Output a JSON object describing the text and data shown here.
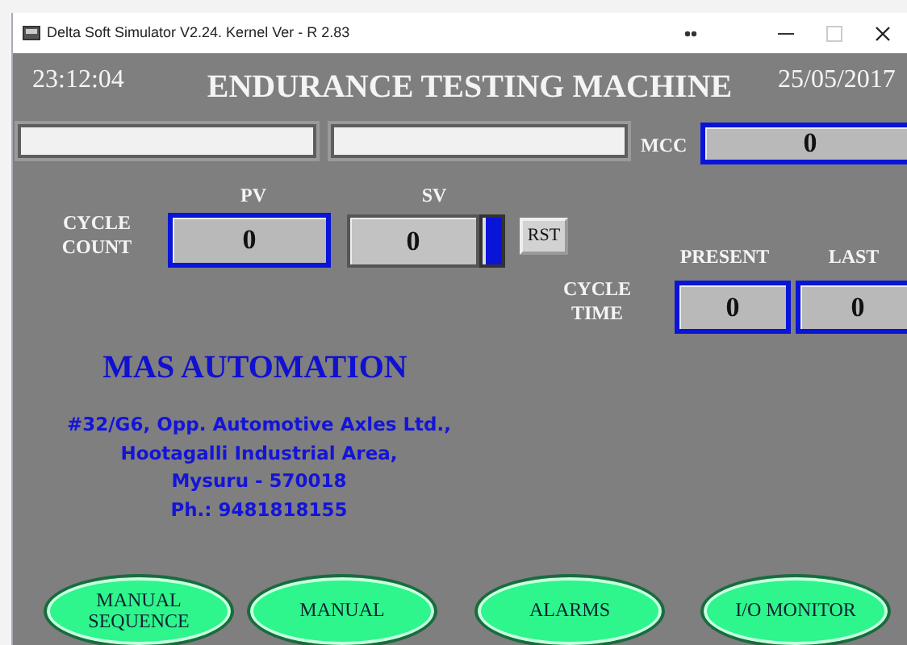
{
  "window": {
    "title": "Delta Soft Simulator V2.24. Kernel Ver - R 2.83"
  },
  "header": {
    "time": "23:12:04",
    "title": "ENDURANCE TESTING MACHINE",
    "date": "25/05/2017"
  },
  "mcc": {
    "label": "MCC",
    "value": "0"
  },
  "cycle_count": {
    "label": "CYCLE COUNT",
    "pv_label": "PV",
    "sv_label": "SV",
    "pv": "0",
    "sv": "0",
    "reset_button": "RST"
  },
  "cycle_time": {
    "label": "CYCLE TIME",
    "present_label": "PRESENT",
    "last_label": "LAST",
    "present": "0",
    "last": "0"
  },
  "company": {
    "name": "MAS AUTOMATION",
    "address": [
      "#32/G6, Opp. Automotive Axles Ltd.,",
      "Hootagalli Industrial Area,",
      "Mysuru - 570018",
      "Ph.: 9481818155"
    ]
  },
  "buttons": [
    "MANUAL SEQUENCE",
    "MANUAL",
    "ALARMS",
    "I/O MONITOR"
  ]
}
